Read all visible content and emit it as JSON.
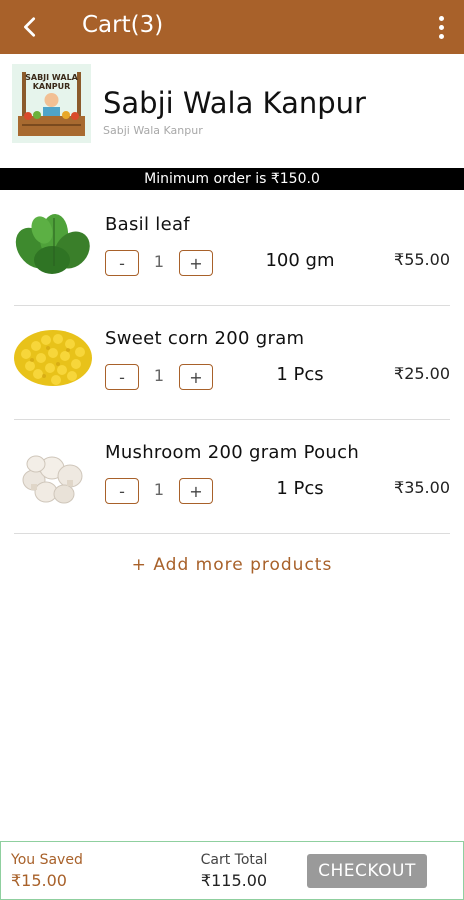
{
  "header": {
    "title": "Cart(3)",
    "back_icon": "back-arrow-icon",
    "menu_icon": "more-vertical-icon",
    "background_color": "#a8612a"
  },
  "store": {
    "name": "Sabji Wala Kanpur",
    "subtitle": "Sabji Wala Kanpur",
    "logo_text_line1": "SABJI WALA",
    "logo_text_line2": "KANPUR"
  },
  "min_order_text": "Minimum order is ₹150.0",
  "items": [
    {
      "name": "Basil leaf",
      "qty": "1",
      "unit": "100 gm",
      "price": "₹55.00",
      "image_icon": "basil-leaf-image",
      "minus_label": "-",
      "plus_label": "+"
    },
    {
      "name": "Sweet corn 200 gram",
      "qty": "1",
      "unit": "1 Pcs",
      "price": "₹25.00",
      "image_icon": "sweet-corn-image",
      "minus_label": "-",
      "plus_label": "+"
    },
    {
      "name": "Mushroom 200 gram Pouch",
      "qty": "1",
      "unit": "1 Pcs",
      "price": "₹35.00",
      "image_icon": "mushroom-image",
      "minus_label": "-",
      "plus_label": "+"
    }
  ],
  "add_more_label": "+ Add more products",
  "footer": {
    "saved_label": "You Saved",
    "saved_value": "₹15.00",
    "total_label": "Cart Total",
    "total_value": "₹115.00",
    "checkout_label": "CHECKOUT",
    "accent_color": "#a8612a",
    "checkout_color": "#9a9a9a"
  }
}
